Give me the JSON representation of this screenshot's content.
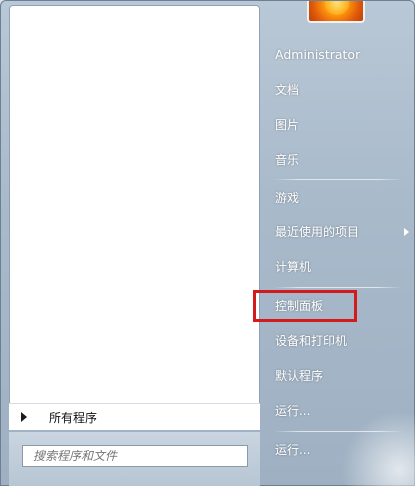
{
  "user": {
    "name": "Administrator"
  },
  "right_menu": {
    "items": [
      {
        "label": "文档"
      },
      {
        "label": "图片"
      },
      {
        "label": "音乐"
      },
      {
        "label": "游戏"
      },
      {
        "label": "最近使用的项目"
      },
      {
        "label": "计算机"
      },
      {
        "label": "控制面板"
      },
      {
        "label": "设备和打印机"
      },
      {
        "label": "默认程序"
      },
      {
        "label": "运行..."
      }
    ],
    "shutdown_label": "运行..."
  },
  "left_pane": {
    "all_programs_label": "所有程序"
  },
  "search": {
    "placeholder": "搜索程序和文件"
  },
  "colors": {
    "highlight": "#d31b1b"
  }
}
